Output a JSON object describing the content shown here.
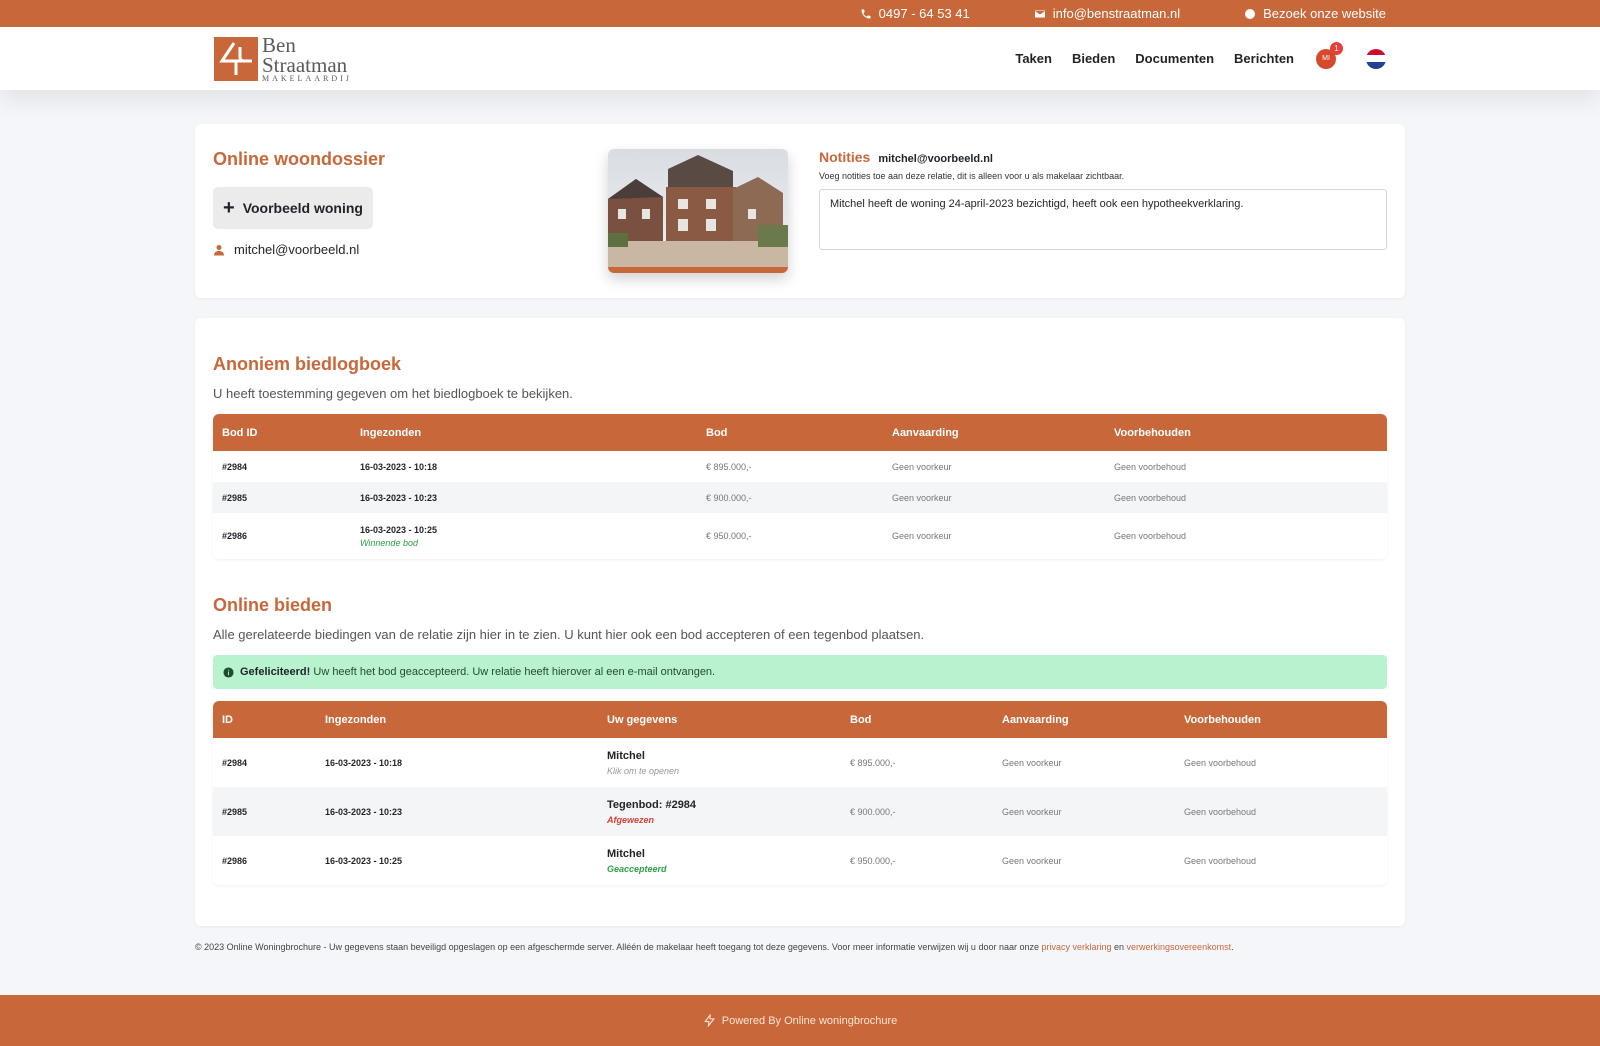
{
  "topbar": {
    "phone": "0497 - 64 53 41",
    "email": "info@benstraatman.nl",
    "website": "Bezoek onze website"
  },
  "brand": {
    "line1": "Ben",
    "line2": "Straatman",
    "line3": "MAKELAARDIJ"
  },
  "nav": {
    "items": [
      "Taken",
      "Bieden",
      "Documenten",
      "Berichten"
    ],
    "avatar_initials": "MI",
    "notification_count": "1"
  },
  "dossier": {
    "title": "Online woondossier",
    "property_button": "Voorbeeld woning",
    "user_email": "mitchel@voorbeeld.nl"
  },
  "notes": {
    "title": "Notities",
    "email": "mitchel@voorbeeld.nl",
    "hint": "Voeg notities toe aan deze relatie, dit is alleen voor u als makelaar zichtbaar.",
    "value": "Mitchel heeft de woning 24-april-2023 bezichtigd, heeft ook een hypotheekverklaring."
  },
  "biedlogboek": {
    "title": "Anoniem biedlogboek",
    "subtitle": "U heeft toestemming gegeven om het biedlogboek te bekijken.",
    "headers": [
      "Bod ID",
      "Ingezonden",
      "Bod",
      "Aanvaarding",
      "Voorbehouden"
    ],
    "rows": [
      {
        "id": "#2984",
        "submitted": "16-03-2023 - 10:18",
        "note": "",
        "bid": "€ 895.000,-",
        "acceptance": "Geen voorkeur",
        "reservations": "Geen voorbehoud"
      },
      {
        "id": "#2985",
        "submitted": "16-03-2023 - 10:23",
        "note": "",
        "bid": "€ 900.000,-",
        "acceptance": "Geen voorkeur",
        "reservations": "Geen voorbehoud"
      },
      {
        "id": "#2986",
        "submitted": "16-03-2023 - 10:25",
        "note": "Winnende bod",
        "bid": "€ 950.000,-",
        "acceptance": "Geen voorkeur",
        "reservations": "Geen voorbehoud"
      }
    ]
  },
  "bieden": {
    "title": "Online bieden",
    "subtitle": "Alle gerelateerde biedingen van de relatie zijn hier in te zien. U kunt hier ook een bod accepteren of een tegenbod plaatsen.",
    "alert_strong": "Gefeliciteerd!",
    "alert_text": " Uw heeft het bod geaccepteerd. Uw relatie heeft hierover al een e-mail ontvangen.",
    "headers": [
      "ID",
      "Ingezonden",
      "Uw gegevens",
      "Bod",
      "Aanvaarding",
      "Voorbehouden"
    ],
    "rows": [
      {
        "id": "#2984",
        "submitted": "16-03-2023 - 10:18",
        "name": "Mitchel",
        "status": "Klik om te openen",
        "bid": "€ 895.000,-",
        "acceptance": "Geen voorkeur",
        "reservations": "Geen voorbehoud"
      },
      {
        "id": "#2985",
        "submitted": "16-03-2023 - 10:23",
        "name": "Tegenbod: #2984",
        "status": "Afgewezen",
        "bid": "€ 900.000,-",
        "acceptance": "Geen voorkeur",
        "reservations": "Geen voorbehoud"
      },
      {
        "id": "#2986",
        "submitted": "16-03-2023 - 10:25",
        "name": "Mitchel",
        "status": "Geaccepteerd",
        "bid": "€ 950.000,-",
        "acceptance": "Geen voorkeur",
        "reservations": "Geen voorbehoud"
      }
    ]
  },
  "legal": {
    "text": "© 2023 Online Woningbrochure - Uw gegevens staan beveiligd opgeslagen op een afgeschermde server. Alléén de makelaar heeft toegang tot deze gegevens. Voor meer informatie verwijzen wij u door naar onze ",
    "privacy_link": "privacy verklaring",
    "and": " en ",
    "processing_link": "verwerkingsovereenkomst",
    "end": "."
  },
  "footer": {
    "text": "Powered By Online woningbrochure"
  },
  "colors": {
    "brand": "#c8683a",
    "success_bg": "#b9f2cf",
    "success_text": "#2e9e45",
    "danger_text": "#d94035"
  }
}
